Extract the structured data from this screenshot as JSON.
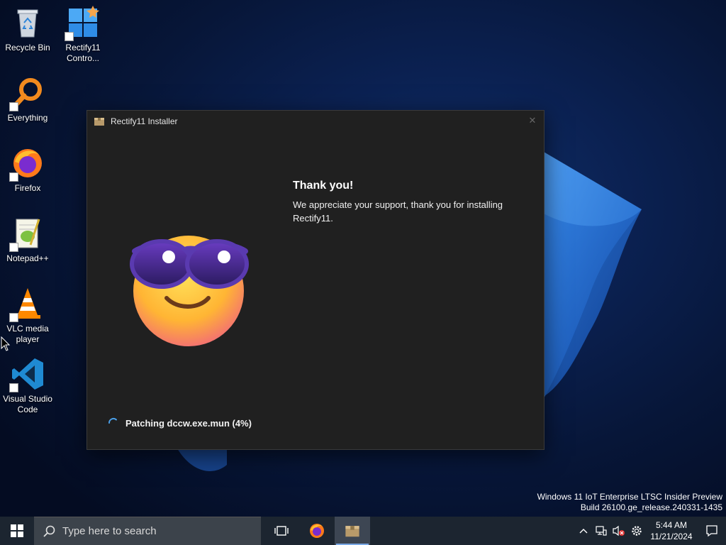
{
  "desktop": {
    "icons": [
      {
        "label": "Recycle Bin",
        "icon": "recycle-bin-icon"
      },
      {
        "label": "Rectify11 Contro...",
        "icon": "rectify11-control-panel-icon"
      },
      {
        "label": "Everything",
        "icon": "everything-search-icon"
      },
      {
        "label": "Firefox",
        "icon": "firefox-icon"
      },
      {
        "label": "Notepad++",
        "icon": "notepadpp-icon"
      },
      {
        "label": "VLC media player",
        "icon": "vlc-icon"
      },
      {
        "label": "Visual Studio Code",
        "icon": "vscode-icon"
      }
    ]
  },
  "installer": {
    "title": "Rectify11 Installer",
    "close_glyph": "✕",
    "heading": "Thank you!",
    "message": "We appreciate your support, thank you for installing Rectify11.",
    "status": "Patching dccw.exe.mun (4%)",
    "progress_percent": 4
  },
  "watermark": {
    "line1": "Windows 11 IoT Enterprise LTSC Insider Preview",
    "line2": "Build 26100.ge_release.240331-1435"
  },
  "taskbar": {
    "search_placeholder": "Type here to search",
    "time": "5:44 AM",
    "date": "11/21/2024"
  },
  "colors": {
    "window_bg": "#202020",
    "taskbar_bg": "#1c2530",
    "accent": "#4a9fe8"
  }
}
